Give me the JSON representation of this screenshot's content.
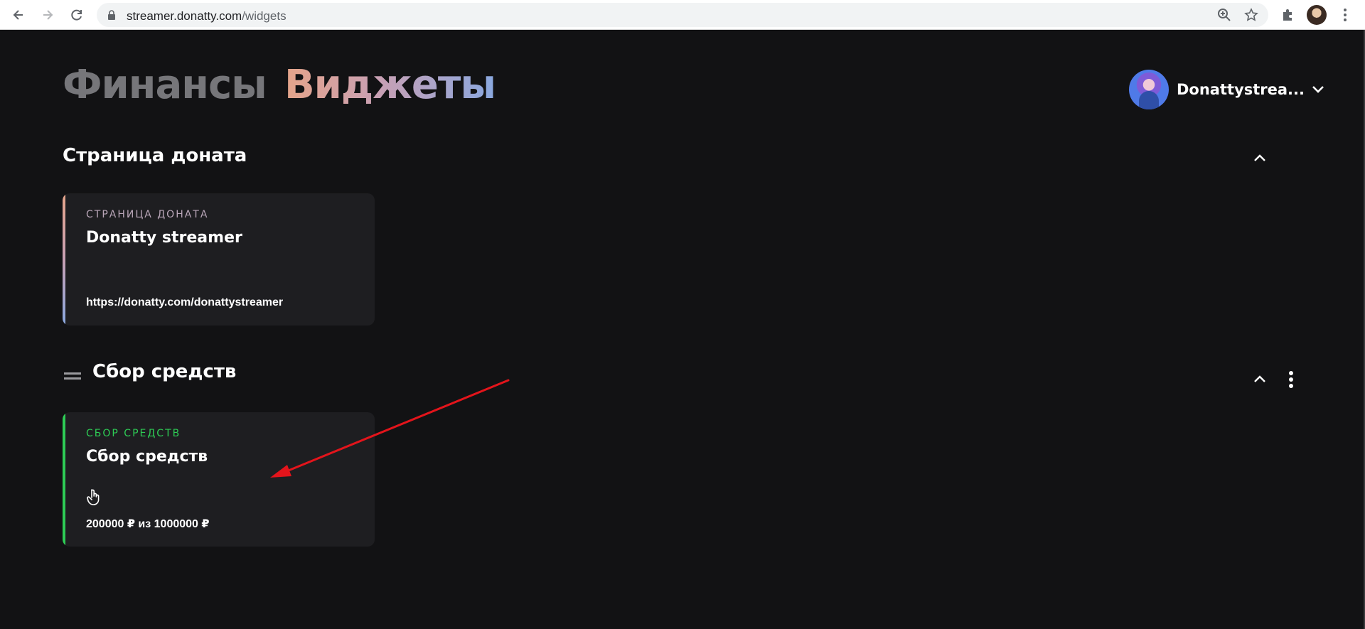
{
  "browser": {
    "url_host": "streamer.donatty.com",
    "url_path": "/widgets"
  },
  "header": {
    "tabs": [
      {
        "label": "Финансы",
        "active": false
      },
      {
        "label": "Виджеты",
        "active": true
      }
    ],
    "user": {
      "name": "Donattystrea..."
    }
  },
  "sections": {
    "donation_page": {
      "title": "Страница доната",
      "card": {
        "label": "СТРАНИЦА ДОНАТА",
        "name": "Donatty streamer",
        "link": "https://donatty.com/donattystreamer"
      }
    },
    "fundraising": {
      "title": "Сбор средств",
      "card": {
        "label": "СБОР СРЕДСТВ",
        "name": "Сбор средств",
        "icon": "hand-pointer-icon",
        "progress_text": "200000 ₽ из 1000000 ₽",
        "progress_fraction": 0.2
      }
    }
  },
  "colors": {
    "background": "#121214",
    "card": "#1e1e21",
    "fundraising_accent": "#2ecc55",
    "donation_label": "#b9a6b8",
    "annotation_arrow": "#e3141b"
  }
}
